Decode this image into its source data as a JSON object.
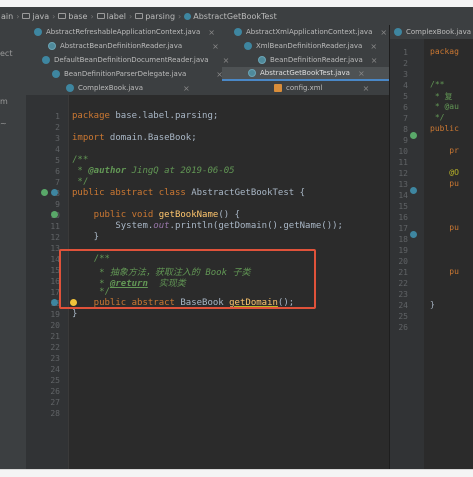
{
  "breadcrumb": {
    "items": [
      "ain",
      "java",
      "base",
      "label",
      "parsing",
      "AbstractGetBookTest"
    ]
  },
  "left_panel": {
    "labels": [
      "ect",
      "m",
      "~"
    ]
  },
  "tabs": {
    "row1": [
      {
        "label": "AbstractRefreshableApplicationContext.java",
        "icon": "class"
      },
      {
        "label": "AbstractXmlApplicationContext.java",
        "icon": "class"
      }
    ],
    "row2": [
      {
        "label": "AbstractBeanDefinitionReader.java",
        "icon": "abstract-class"
      },
      {
        "label": "XmlBeanDefinitionReader.java",
        "icon": "class"
      }
    ],
    "row3": [
      {
        "label": "DefaultBeanDefinitionDocumentReader.java",
        "icon": "class"
      },
      {
        "label": "BeanDefinitionReader.java",
        "icon": "interface"
      }
    ],
    "row4": [
      {
        "label": "BeanDefinitionParserDelegate.java",
        "icon": "class"
      },
      {
        "label": "AbstractGetBookTest.java",
        "icon": "abstract-class",
        "active": true
      }
    ],
    "row5": [
      {
        "label": "ComplexBook.java",
        "icon": "class"
      },
      {
        "label": "config.xml",
        "icon": "xml"
      }
    ],
    "close_glyph": "×"
  },
  "editor": {
    "line_numbers": [
      "1",
      "2",
      "3",
      "4",
      "5",
      "6",
      "7",
      "8",
      "9",
      "10",
      "11",
      "12",
      "13",
      "14",
      "15",
      "16",
      "17",
      "18",
      "19",
      "20",
      "21",
      "22",
      "23",
      "24",
      "25",
      "26",
      "27",
      "28"
    ],
    "code": {
      "l1_kw": "package",
      "l1_rest": " base.label.parsing;",
      "l3_kw": "import",
      "l3_rest": " domain.BaseBook;",
      "l5": "/**",
      "l6_star": " * ",
      "l6_tag": "@author",
      "l6_rest": " JingQ at 2019-06-05",
      "l7": " */",
      "l8_kw": "public abstract class",
      "l8_rest": " AbstractGetBookTest {",
      "l10_kw": "    public void",
      "l10_fn": " getBookName",
      "l10_rest": "() {",
      "l11_a": "        System.",
      "l11_it": "out",
      "l11_b": ".println(",
      "l11_fn": "getDomain",
      "l11_c": "().getName());",
      "l12": "    }",
      "l14": "    /**",
      "l15": "     * 抽象方法，获取注入的 Book 子类",
      "l16_star": "     * ",
      "l16_tag": "@return",
      "l16_rest": "  实现类",
      "l17": "     */",
      "l18_kw": "    public abstract",
      "l18_type": " BaseBook ",
      "l18_fn": "getDomain",
      "l18_rest": "();",
      "l19": "}"
    }
  },
  "right_editor": {
    "tab_label": "ComplexBook.java",
    "line_numbers": [
      "1",
      "2",
      "3",
      "4",
      "5",
      "6",
      "7",
      "8",
      "9",
      "10",
      "11",
      "12",
      "13",
      "14",
      "15",
      "16",
      "17",
      "18",
      "19",
      "20",
      "21",
      "22",
      "23",
      "24",
      "25",
      "26"
    ],
    "lines": [
      {
        "text": "packag",
        "color": "#cc7832",
        "line": 1
      },
      {
        "text": "/**",
        "color": "#629755",
        "line": 4
      },
      {
        "text": " * 复",
        "color": "#629755",
        "line": 5
      },
      {
        "text": " * @au",
        "color": "#629755",
        "line": 6
      },
      {
        "text": " */",
        "color": "#629755",
        "line": 7
      },
      {
        "text": "public",
        "color": "#cc7832",
        "line": 8
      },
      {
        "text": "    pr",
        "color": "#cc7832",
        "line": 10
      },
      {
        "text": "    @O",
        "color": "#bbb529",
        "line": 12
      },
      {
        "text": "    pu",
        "color": "#cc7832",
        "line": 13
      },
      {
        "text": "    pu",
        "color": "#cc7832",
        "line": 17
      },
      {
        "text": "    pu",
        "color": "#cc7832",
        "line": 21
      },
      {
        "text": "}",
        "color": "#a9b7c6",
        "line": 24
      }
    ]
  }
}
